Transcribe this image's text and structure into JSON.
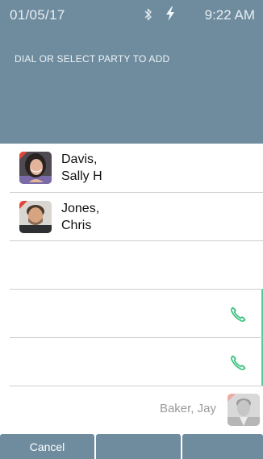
{
  "status_bar": {
    "date": "01/05/17",
    "time": "9:22 AM",
    "bluetooth_icon": "bluetooth-icon",
    "power_icon": "lightning-bolt-icon"
  },
  "header": {
    "prompt": "DIAL OR SELECT PARTY TO ADD"
  },
  "contacts": [
    {
      "name_line1": "Davis,",
      "name_line2": "Sally H",
      "presence_color": "#e0453a"
    },
    {
      "name_line1": "Jones,",
      "name_line2": "Chris",
      "presence_color": "#e0453a"
    }
  ],
  "call_rows": [
    {
      "icon": "phone-handset-icon",
      "color": "#3cc37f"
    },
    {
      "icon": "phone-handset-icon",
      "color": "#3cc37f"
    }
  ],
  "party": {
    "name": "Baker, Jay"
  },
  "softkeys": {
    "cancel_label": "Cancel",
    "key2_label": "",
    "key3_label": ""
  },
  "colors": {
    "header_bg": "#6f8c9f",
    "accent_green": "#3cc37f",
    "presence_red": "#e0453a"
  }
}
